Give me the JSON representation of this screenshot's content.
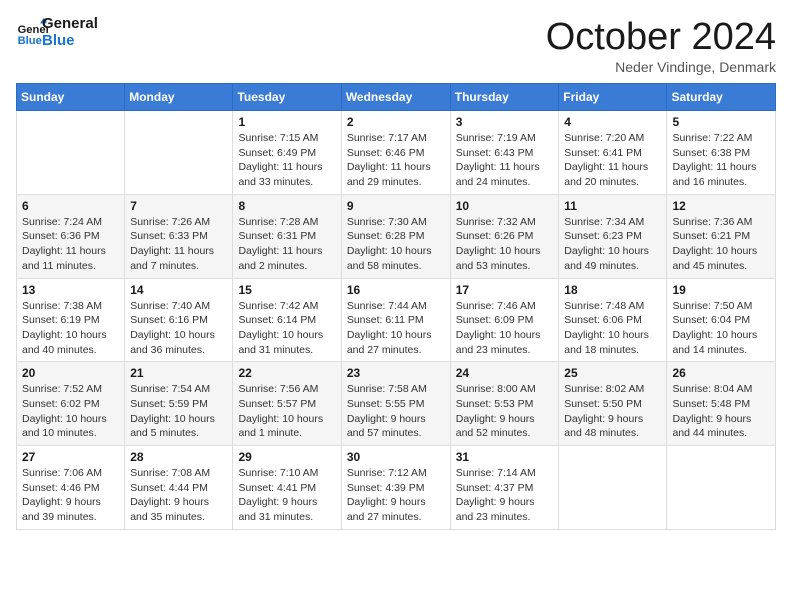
{
  "logo": {
    "line1": "General",
    "line2": "Blue"
  },
  "title": "October 2024",
  "location": "Neder Vindinge, Denmark",
  "days_of_week": [
    "Sunday",
    "Monday",
    "Tuesday",
    "Wednesday",
    "Thursday",
    "Friday",
    "Saturday"
  ],
  "weeks": [
    [
      {
        "day": "",
        "sunrise": "",
        "sunset": "",
        "daylight": ""
      },
      {
        "day": "",
        "sunrise": "",
        "sunset": "",
        "daylight": ""
      },
      {
        "day": "1",
        "sunrise": "Sunrise: 7:15 AM",
        "sunset": "Sunset: 6:49 PM",
        "daylight": "Daylight: 11 hours and 33 minutes."
      },
      {
        "day": "2",
        "sunrise": "Sunrise: 7:17 AM",
        "sunset": "Sunset: 6:46 PM",
        "daylight": "Daylight: 11 hours and 29 minutes."
      },
      {
        "day": "3",
        "sunrise": "Sunrise: 7:19 AM",
        "sunset": "Sunset: 6:43 PM",
        "daylight": "Daylight: 11 hours and 24 minutes."
      },
      {
        "day": "4",
        "sunrise": "Sunrise: 7:20 AM",
        "sunset": "Sunset: 6:41 PM",
        "daylight": "Daylight: 11 hours and 20 minutes."
      },
      {
        "day": "5",
        "sunrise": "Sunrise: 7:22 AM",
        "sunset": "Sunset: 6:38 PM",
        "daylight": "Daylight: 11 hours and 16 minutes."
      }
    ],
    [
      {
        "day": "6",
        "sunrise": "Sunrise: 7:24 AM",
        "sunset": "Sunset: 6:36 PM",
        "daylight": "Daylight: 11 hours and 11 minutes."
      },
      {
        "day": "7",
        "sunrise": "Sunrise: 7:26 AM",
        "sunset": "Sunset: 6:33 PM",
        "daylight": "Daylight: 11 hours and 7 minutes."
      },
      {
        "day": "8",
        "sunrise": "Sunrise: 7:28 AM",
        "sunset": "Sunset: 6:31 PM",
        "daylight": "Daylight: 11 hours and 2 minutes."
      },
      {
        "day": "9",
        "sunrise": "Sunrise: 7:30 AM",
        "sunset": "Sunset: 6:28 PM",
        "daylight": "Daylight: 10 hours and 58 minutes."
      },
      {
        "day": "10",
        "sunrise": "Sunrise: 7:32 AM",
        "sunset": "Sunset: 6:26 PM",
        "daylight": "Daylight: 10 hours and 53 minutes."
      },
      {
        "day": "11",
        "sunrise": "Sunrise: 7:34 AM",
        "sunset": "Sunset: 6:23 PM",
        "daylight": "Daylight: 10 hours and 49 minutes."
      },
      {
        "day": "12",
        "sunrise": "Sunrise: 7:36 AM",
        "sunset": "Sunset: 6:21 PM",
        "daylight": "Daylight: 10 hours and 45 minutes."
      }
    ],
    [
      {
        "day": "13",
        "sunrise": "Sunrise: 7:38 AM",
        "sunset": "Sunset: 6:19 PM",
        "daylight": "Daylight: 10 hours and 40 minutes."
      },
      {
        "day": "14",
        "sunrise": "Sunrise: 7:40 AM",
        "sunset": "Sunset: 6:16 PM",
        "daylight": "Daylight: 10 hours and 36 minutes."
      },
      {
        "day": "15",
        "sunrise": "Sunrise: 7:42 AM",
        "sunset": "Sunset: 6:14 PM",
        "daylight": "Daylight: 10 hours and 31 minutes."
      },
      {
        "day": "16",
        "sunrise": "Sunrise: 7:44 AM",
        "sunset": "Sunset: 6:11 PM",
        "daylight": "Daylight: 10 hours and 27 minutes."
      },
      {
        "day": "17",
        "sunrise": "Sunrise: 7:46 AM",
        "sunset": "Sunset: 6:09 PM",
        "daylight": "Daylight: 10 hours and 23 minutes."
      },
      {
        "day": "18",
        "sunrise": "Sunrise: 7:48 AM",
        "sunset": "Sunset: 6:06 PM",
        "daylight": "Daylight: 10 hours and 18 minutes."
      },
      {
        "day": "19",
        "sunrise": "Sunrise: 7:50 AM",
        "sunset": "Sunset: 6:04 PM",
        "daylight": "Daylight: 10 hours and 14 minutes."
      }
    ],
    [
      {
        "day": "20",
        "sunrise": "Sunrise: 7:52 AM",
        "sunset": "Sunset: 6:02 PM",
        "daylight": "Daylight: 10 hours and 10 minutes."
      },
      {
        "day": "21",
        "sunrise": "Sunrise: 7:54 AM",
        "sunset": "Sunset: 5:59 PM",
        "daylight": "Daylight: 10 hours and 5 minutes."
      },
      {
        "day": "22",
        "sunrise": "Sunrise: 7:56 AM",
        "sunset": "Sunset: 5:57 PM",
        "daylight": "Daylight: 10 hours and 1 minute."
      },
      {
        "day": "23",
        "sunrise": "Sunrise: 7:58 AM",
        "sunset": "Sunset: 5:55 PM",
        "daylight": "Daylight: 9 hours and 57 minutes."
      },
      {
        "day": "24",
        "sunrise": "Sunrise: 8:00 AM",
        "sunset": "Sunset: 5:53 PM",
        "daylight": "Daylight: 9 hours and 52 minutes."
      },
      {
        "day": "25",
        "sunrise": "Sunrise: 8:02 AM",
        "sunset": "Sunset: 5:50 PM",
        "daylight": "Daylight: 9 hours and 48 minutes."
      },
      {
        "day": "26",
        "sunrise": "Sunrise: 8:04 AM",
        "sunset": "Sunset: 5:48 PM",
        "daylight": "Daylight: 9 hours and 44 minutes."
      }
    ],
    [
      {
        "day": "27",
        "sunrise": "Sunrise: 7:06 AM",
        "sunset": "Sunset: 4:46 PM",
        "daylight": "Daylight: 9 hours and 39 minutes."
      },
      {
        "day": "28",
        "sunrise": "Sunrise: 7:08 AM",
        "sunset": "Sunset: 4:44 PM",
        "daylight": "Daylight: 9 hours and 35 minutes."
      },
      {
        "day": "29",
        "sunrise": "Sunrise: 7:10 AM",
        "sunset": "Sunset: 4:41 PM",
        "daylight": "Daylight: 9 hours and 31 minutes."
      },
      {
        "day": "30",
        "sunrise": "Sunrise: 7:12 AM",
        "sunset": "Sunset: 4:39 PM",
        "daylight": "Daylight: 9 hours and 27 minutes."
      },
      {
        "day": "31",
        "sunrise": "Sunrise: 7:14 AM",
        "sunset": "Sunset: 4:37 PM",
        "daylight": "Daylight: 9 hours and 23 minutes."
      },
      {
        "day": "",
        "sunrise": "",
        "sunset": "",
        "daylight": ""
      },
      {
        "day": "",
        "sunrise": "",
        "sunset": "",
        "daylight": ""
      }
    ]
  ]
}
